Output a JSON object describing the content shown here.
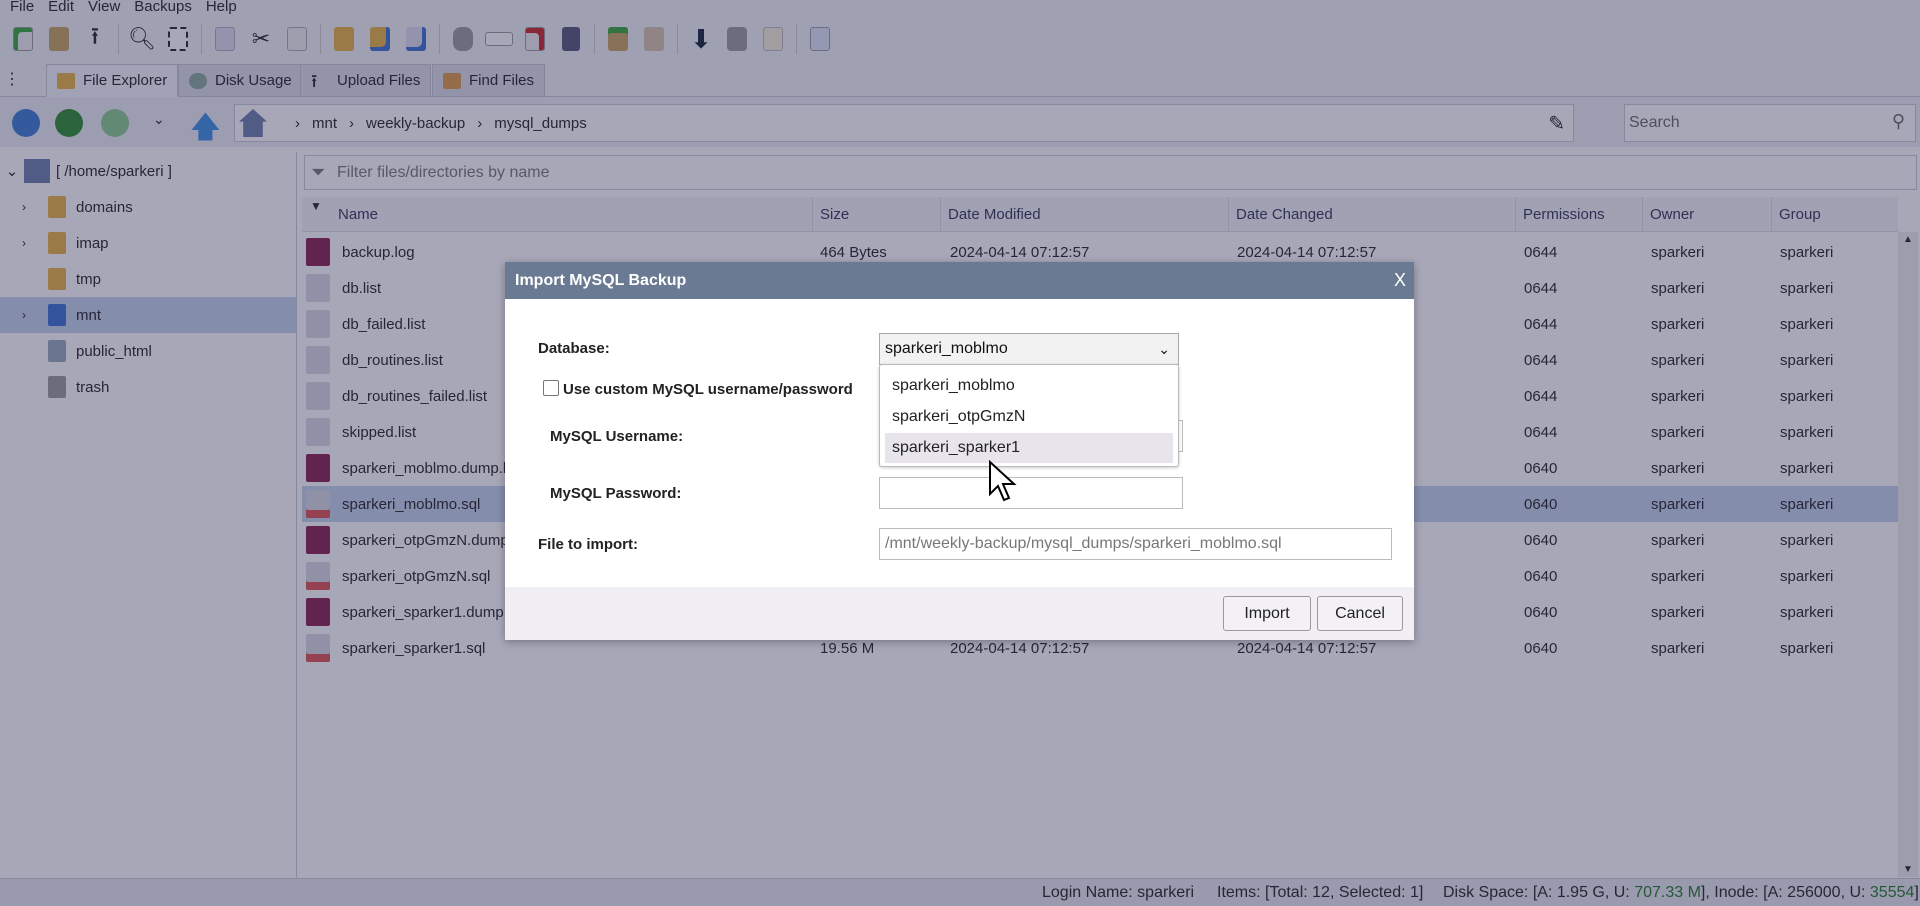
{
  "menu": [
    "File",
    "Edit",
    "View",
    "Backups",
    "Help"
  ],
  "tabs": [
    {
      "label": "File Explorer",
      "icon": "folder-icon"
    },
    {
      "label": "Disk Usage",
      "icon": "disk-icon"
    },
    {
      "label": "Upload Files",
      "icon": "upload-icon"
    },
    {
      "label": "Find Files",
      "icon": "find-files-icon"
    }
  ],
  "breadcrumb": [
    "mnt",
    "weekly-backup",
    "mysql_dumps"
  ],
  "search_placeholder": "Search",
  "filter_placeholder": "Filter files/directories by name",
  "tree": {
    "root": "[ /home/sparkeri ]",
    "items": [
      {
        "label": "domains",
        "expandable": true
      },
      {
        "label": "imap",
        "expandable": true
      },
      {
        "label": "tmp",
        "expandable": false
      },
      {
        "label": "mnt",
        "expandable": true,
        "selected": true
      },
      {
        "label": "public_html",
        "expandable": false
      },
      {
        "label": "trash",
        "expandable": false
      }
    ]
  },
  "columns": [
    "Name",
    "Size",
    "Date Modified",
    "Date Changed",
    "Permissions",
    "Owner",
    "Group"
  ],
  "files": [
    {
      "name": "backup.log",
      "type": "log",
      "size": "464 Bytes",
      "modified": "2024-04-14 07:12:57",
      "changed": "2024-04-14 07:12:57",
      "perm": "0644",
      "owner": "sparkeri",
      "group": "sparkeri"
    },
    {
      "name": "db.list",
      "type": "file",
      "size": "",
      "modified": "",
      "changed": "",
      "perm": "0644",
      "owner": "sparkeri",
      "group": "sparkeri"
    },
    {
      "name": "db_failed.list",
      "type": "file",
      "size": "",
      "modified": "",
      "changed": "",
      "perm": "0644",
      "owner": "sparkeri",
      "group": "sparkeri"
    },
    {
      "name": "db_routines.list",
      "type": "file",
      "size": "",
      "modified": "",
      "changed": "",
      "perm": "0644",
      "owner": "sparkeri",
      "group": "sparkeri"
    },
    {
      "name": "db_routines_failed.list",
      "type": "file",
      "size": "",
      "modified": "",
      "changed": "",
      "perm": "0644",
      "owner": "sparkeri",
      "group": "sparkeri"
    },
    {
      "name": "skipped.list",
      "type": "file",
      "size": "",
      "modified": "",
      "changed": "",
      "perm": "0644",
      "owner": "sparkeri",
      "group": "sparkeri"
    },
    {
      "name": "sparkeri_moblmo.dump.l",
      "type": "log",
      "size": "",
      "modified": "",
      "changed": "",
      "perm": "0640",
      "owner": "sparkeri",
      "group": "sparkeri"
    },
    {
      "name": "sparkeri_moblmo.sql",
      "type": "sql",
      "size": "",
      "modified": "",
      "changed": "",
      "perm": "0640",
      "owner": "sparkeri",
      "group": "sparkeri",
      "selected": true
    },
    {
      "name": "sparkeri_otpGmzN.dump",
      "type": "log",
      "size": "",
      "modified": "",
      "changed": "",
      "perm": "0640",
      "owner": "sparkeri",
      "group": "sparkeri"
    },
    {
      "name": "sparkeri_otpGmzN.sql",
      "type": "sql",
      "size": "",
      "modified": "",
      "changed": "",
      "perm": "0640",
      "owner": "sparkeri",
      "group": "sparkeri"
    },
    {
      "name": "sparkeri_sparker1.dump.l",
      "type": "log",
      "size": "",
      "modified": "",
      "changed": "",
      "perm": "0640",
      "owner": "sparkeri",
      "group": "sparkeri"
    },
    {
      "name": "sparkeri_sparker1.sql",
      "type": "sql",
      "size": "19.56 M",
      "modified": "2024-04-14 07:12:57",
      "changed": "2024-04-14 07:12:57",
      "perm": "0640",
      "owner": "sparkeri",
      "group": "sparkeri"
    }
  ],
  "status": {
    "login": "Login Name: sparkeri",
    "items": "Items: [Total: 12, Selected: 1]",
    "disk_prefix": "Disk Space: [A: 1.95 G, U: ",
    "disk_used": "707.33 M",
    "inode_prefix": "], Inode: [A: 256000, U: ",
    "inode_used": "35554",
    "suffix": "]",
    "used_color": "#1f7a1f"
  },
  "dialog": {
    "title": "Import MySQL Backup",
    "close": "X",
    "database_label": "Database:",
    "database_value": "sparkeri_moblmo",
    "options": [
      "sparkeri_moblmo",
      "sparkeri_otpGmzN",
      "sparkeri_sparker1"
    ],
    "highlighted_option": 2,
    "custom_label": "Use custom MySQL username/password",
    "custom_checked": false,
    "username_label": "MySQL Username:",
    "password_label": "MySQL Password:",
    "file_label": "File to import:",
    "file_value": "/mnt/weekly-backup/mysql_dumps/sparkeri_moblmo.sql",
    "import": "Import",
    "cancel": "Cancel"
  }
}
